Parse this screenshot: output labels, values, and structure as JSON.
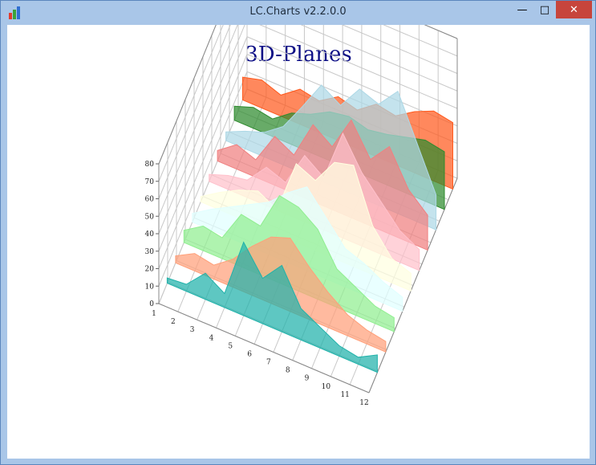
{
  "window": {
    "title": "LC.Charts v2.2.0.0",
    "icons": {
      "app": "bar-chart-icon",
      "minimize": "minimize-icon",
      "maximize": "maximize-icon",
      "close": "close-icon"
    },
    "close_color": "#c7453c"
  },
  "chart_data": {
    "type": "area",
    "title": "3D-Planes",
    "title_color": "#0b0d85",
    "grid": true,
    "projection": "3d-planes",
    "x_ticks": [
      "1",
      "2",
      "3",
      "4",
      "5",
      "6",
      "7",
      "8",
      "9",
      "10",
      "11",
      "12"
    ],
    "z_ticks": [
      "0",
      "10",
      "20",
      "30",
      "40",
      "50",
      "60",
      "70",
      "80"
    ],
    "ylim": [
      0,
      80
    ],
    "series": [
      {
        "color": "#ff5a1e",
        "values": [
          13,
          16,
          12,
          20,
          18,
          25,
          22,
          30,
          28,
          35,
          40,
          38
        ]
      },
      {
        "color": "#2e8b2e",
        "values": [
          8,
          12,
          10,
          18,
          22,
          28,
          30,
          27,
          29,
          32,
          35,
          33
        ]
      },
      {
        "color": "#add8e6",
        "values": [
          5,
          10,
          14,
          22,
          38,
          55,
          48,
          62,
          58,
          70,
          45,
          20
        ]
      },
      {
        "color": "#f08080",
        "values": [
          6,
          14,
          10,
          28,
          22,
          44,
          36,
          56,
          38,
          50,
          30,
          20
        ]
      },
      {
        "color": "#ffc0cb",
        "values": [
          4,
          8,
          10,
          22,
          18,
          38,
          30,
          60,
          42,
          30,
          18,
          12
        ]
      },
      {
        "color": "#ffffe0",
        "values": [
          3,
          10,
          16,
          20,
          14,
          45,
          40,
          55,
          58,
          28,
          14,
          10
        ]
      },
      {
        "color": "#e0ffff",
        "values": [
          5,
          12,
          18,
          24,
          30,
          40,
          48,
          35,
          22,
          18,
          12,
          8
        ]
      },
      {
        "color": "#90ee90",
        "values": [
          7,
          14,
          12,
          30,
          28,
          50,
          48,
          40,
          22,
          16,
          10,
          8
        ]
      },
      {
        "color": "#ffa07a",
        "values": [
          4,
          10,
          8,
          16,
          28,
          38,
          42,
          30,
          20,
          12,
          8,
          6
        ]
      },
      {
        "color": "#20b2aa",
        "values": [
          3,
          4,
          15,
          8,
          42,
          26,
          38,
          18,
          12,
          6,
          4,
          10
        ]
      }
    ]
  }
}
